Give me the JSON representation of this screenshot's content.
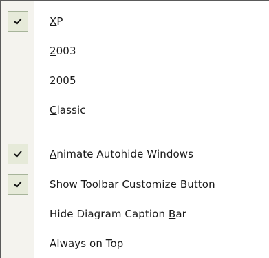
{
  "menu": {
    "items": [
      {
        "pre": "",
        "mn": "X",
        "post": "P",
        "checked": true
      },
      {
        "pre": "",
        "mn": "2",
        "post": "003",
        "checked": false
      },
      {
        "pre": "200",
        "mn": "5",
        "post": "",
        "checked": false
      },
      {
        "pre": "",
        "mn": "C",
        "post": "lassic",
        "checked": false
      },
      {
        "pre": "",
        "mn": "A",
        "post": "nimate Autohide Windows",
        "checked": true
      },
      {
        "pre": "",
        "mn": "S",
        "post": "how Toolbar Customize Button",
        "checked": true
      },
      {
        "pre": "Hide Diagram Caption ",
        "mn": "B",
        "post": "ar",
        "checked": false
      },
      {
        "pre": "Always on Top",
        "mn": "",
        "post": "",
        "checked": false
      }
    ]
  },
  "colors": {
    "gutter": "#f4f3ee",
    "check_bg": "#e6ead9",
    "check_border": "#a7b49a",
    "separator": "#c5c2b8"
  },
  "icons": {
    "check": "checkmark-icon"
  }
}
